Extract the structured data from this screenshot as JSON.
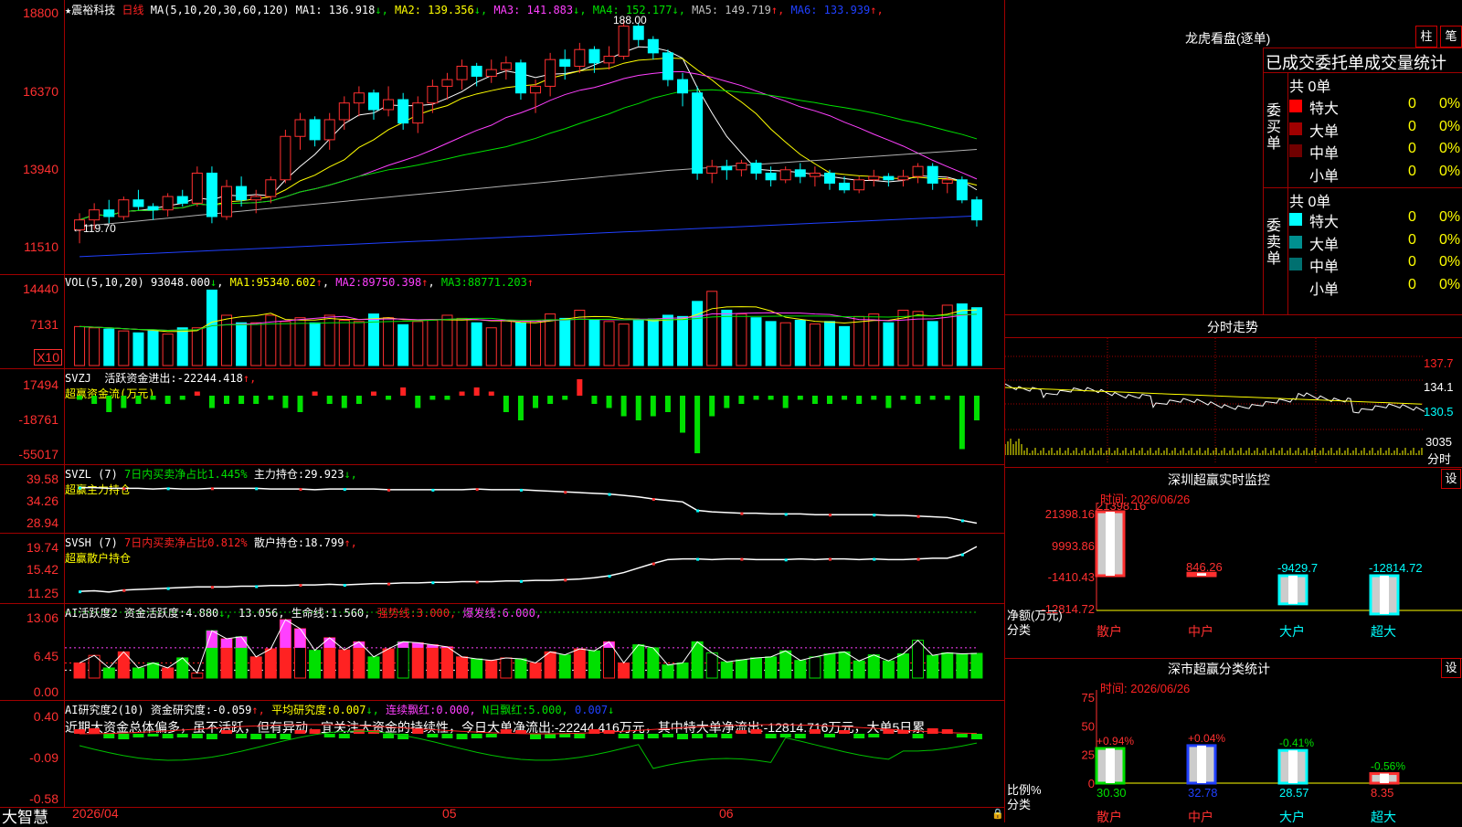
{
  "stock": {
    "name": "★震裕科技",
    "period": "日线"
  },
  "main": {
    "ma_header": "MA(5,10,20,30,60,120)",
    "ma": [
      {
        "label": "MA1:",
        "value": "136.918",
        "arrow": "↓",
        "color": "#ffffff"
      },
      {
        "label": "MA2:",
        "value": "139.356",
        "arrow": "↓",
        "color": "#ffff00"
      },
      {
        "label": "MA3:",
        "value": "141.883",
        "arrow": "↓",
        "color": "#ff40ff"
      },
      {
        "label": "MA4:",
        "value": "152.177",
        "arrow": "↓",
        "color": "#00e000"
      },
      {
        "label": "MA5:",
        "value": "149.719",
        "arrow": "↑",
        "color": "#c0c0c0"
      },
      {
        "label": "MA6:",
        "value": "133.939",
        "arrow": "↑",
        "color": "#2040ff"
      }
    ],
    "y_ticks": [
      "18800",
      "16370",
      "13940",
      "11510"
    ],
    "high_label": "188.00",
    "low_label": "119.70"
  },
  "volume": {
    "header": "VOL(5,10,20)",
    "value": "93048.000",
    "arrow": "↓",
    "ma": [
      {
        "label": "MA1:",
        "value": "95340.602",
        "arrow": "↑"
      },
      {
        "label": "MA2:",
        "value": "89750.398",
        "arrow": "↑"
      },
      {
        "label": "MA3:",
        "value": "88771.203",
        "arrow": "↑"
      }
    ],
    "y_ticks": [
      "14440",
      "7131"
    ],
    "unit": "X10"
  },
  "svzj": {
    "header": "SVZJ",
    "title": "活跃资金进出:",
    "value": "-22244.418",
    "arrow": "↑,",
    "sub": "超赢资金流(万元)",
    "y_ticks": [
      "17494",
      "-18761",
      "-55017"
    ]
  },
  "svzl": {
    "header": "SVZL (7)",
    "title": "7日内买卖净占比1.445%",
    "label2": "主力持仓:",
    "value": "29.923",
    "arrow": "↓,",
    "sub": "超赢主力持仓",
    "y_ticks": [
      "39.58",
      "34.26",
      "28.94"
    ]
  },
  "svsh": {
    "header": "SVSH (7)",
    "title": "7日内买卖净占比0.812%",
    "label2": "散户持仓:",
    "value": "18.799",
    "arrow": "↑,",
    "sub": "超赢散户持仓",
    "y_ticks": [
      "19.74",
      "15.42",
      "11.25"
    ]
  },
  "ai_active": {
    "header": "AI活跃度2",
    "l1": "资金活跃度:",
    "v1": "4.880",
    "a1": "↓,",
    "v2": "13.056,",
    "l3": "生命线:",
    "v3": "1.560,",
    "l4": "强势线:",
    "v4": "3.000,",
    "l5": "爆发线:",
    "v5": "6.000,",
    "y_ticks": [
      "13.06",
      "6.45",
      "0.00"
    ]
  },
  "ai_research": {
    "header": "AI研究度2(10)",
    "l1": "资金研究度:",
    "v1": "-0.059",
    "a1": "↑,",
    "l2": "平均研究度:",
    "v2": "0.007",
    "a2": "↓,",
    "l3": "连续飘红:",
    "v3": "0.000,",
    "l4": "N日飘红:",
    "v4": "5.000,",
    "v5": "0.007",
    "a5": "↓",
    "commentary": "近期大资金总体偏多，虽不活跃，但有异动，宜关注大资金的持续性，今日大单净流出:-22244.416万元，其中特大单净流出:-12814.716万元，大单5日累",
    "y_ticks": [
      "0.40",
      "-0.09",
      "-0.58"
    ]
  },
  "xaxis": {
    "labels": [
      "2026/04",
      "05",
      "06"
    ],
    "brand": "大智慧"
  },
  "right": {
    "lhb": {
      "title": "龙虎看盘(逐单)",
      "btn1": "柱",
      "btn2": "笔",
      "subtitle": "已成交委托单成交量统计",
      "buy": {
        "side": "委买单",
        "total": "共 0单",
        "rows": [
          {
            "name": "特大",
            "count": "0",
            "pct": "0%",
            "color": "#ff0000"
          },
          {
            "name": "大单",
            "count": "0",
            "pct": "0%",
            "color": "#a00000"
          },
          {
            "name": "中单",
            "count": "0",
            "pct": "0%",
            "color": "#700000"
          },
          {
            "name": "小单",
            "count": "0",
            "pct": "0%",
            "color": "#000000"
          }
        ]
      },
      "sell": {
        "side": "委卖单",
        "total": "共 0单",
        "rows": [
          {
            "name": "特大",
            "count": "0",
            "pct": "0%",
            "color": "#00ffff"
          },
          {
            "name": "大单",
            "count": "0",
            "pct": "0%",
            "color": "#009090"
          },
          {
            "name": "中单",
            "count": "0",
            "pct": "0%",
            "color": "#007070"
          },
          {
            "name": "小单",
            "count": "0",
            "pct": "0%",
            "color": "#000000"
          }
        ]
      }
    },
    "intraday": {
      "title": "分时走势",
      "y_ticks": [
        "137.7",
        "134.1",
        "130.5"
      ],
      "vol_tick": "3035",
      "vol_label": "分时"
    },
    "sz_monitor": {
      "title": "深圳超赢实时监控",
      "set": "设",
      "time": "时间: 2026/06/26",
      "y_ticks": [
        "21398.16",
        "9993.86",
        "-1410.43",
        "-12814.72"
      ],
      "y_unit": "净额(万元)",
      "y_unit2": "分类",
      "bars": [
        {
          "cat": "散户",
          "value": 21398.16,
          "label": "21398.16"
        },
        {
          "cat": "中户",
          "value": 846.26,
          "label": "846.26"
        },
        {
          "cat": "大户",
          "value": -9429.7,
          "label": "-9429.7"
        },
        {
          "cat": "超大",
          "value": -12814.72,
          "label": "-12814.72"
        }
      ]
    },
    "sz_class": {
      "title": "深市超赢分类统计",
      "set": "设",
      "time": "时间: 2026/06/26",
      "y_ticks": [
        "75",
        "50",
        "25",
        "0"
      ],
      "y_unit": "比例%",
      "y_unit2": "分类",
      "bars": [
        {
          "cat": "散户",
          "value": 30.3,
          "label": "30.30",
          "chg": "+0.94%"
        },
        {
          "cat": "中户",
          "value": 32.78,
          "label": "32.78",
          "chg": "+0.04%"
        },
        {
          "cat": "大户",
          "value": 28.57,
          "label": "28.57",
          "chg": "-0.41%"
        },
        {
          "cat": "超大",
          "value": 8.35,
          "label": "8.35",
          "chg": "-0.56%"
        }
      ]
    }
  },
  "chart_data": {
    "type": "candlestick",
    "candles": [
      [
        125,
        130,
        121,
        128
      ],
      [
        128,
        133,
        125,
        131
      ],
      [
        131,
        134,
        127,
        129
      ],
      [
        129,
        135,
        128,
        134
      ],
      [
        134,
        137,
        131,
        132
      ],
      [
        132,
        133,
        128,
        131
      ],
      [
        131,
        136,
        129,
        135
      ],
      [
        135,
        137,
        132,
        133
      ],
      [
        133,
        144,
        132,
        142
      ],
      [
        142,
        144,
        127,
        129
      ],
      [
        129,
        140,
        128,
        138
      ],
      [
        138,
        141,
        132,
        134
      ],
      [
        134,
        137,
        130,
        135
      ],
      [
        135,
        141,
        133,
        140
      ],
      [
        140,
        155,
        139,
        153
      ],
      [
        153,
        160,
        149,
        158
      ],
      [
        158,
        159,
        150,
        152
      ],
      [
        152,
        160,
        149,
        158
      ],
      [
        158,
        165,
        155,
        163
      ],
      [
        163,
        168,
        159,
        166
      ],
      [
        166,
        167,
        158,
        161
      ],
      [
        161,
        168,
        159,
        164
      ],
      [
        164,
        166,
        155,
        157
      ],
      [
        157,
        165,
        154,
        163
      ],
      [
        163,
        170,
        160,
        168
      ],
      [
        168,
        172,
        164,
        170
      ],
      [
        170,
        176,
        167,
        174
      ],
      [
        174,
        175,
        168,
        171
      ],
      [
        171,
        176,
        169,
        173
      ],
      [
        173,
        177,
        170,
        175
      ],
      [
        175,
        176,
        164,
        166
      ],
      [
        166,
        170,
        160,
        168
      ],
      [
        168,
        178,
        165,
        176
      ],
      [
        176,
        179,
        170,
        174
      ],
      [
        174,
        181,
        172,
        179
      ],
      [
        179,
        180,
        172,
        175
      ],
      [
        175,
        180,
        173,
        177
      ],
      [
        177,
        188,
        176,
        186
      ],
      [
        186,
        187,
        180,
        182
      ],
      [
        182,
        183,
        176,
        178
      ],
      [
        178,
        179,
        168,
        170
      ],
      [
        170,
        172,
        162,
        166
      ],
      [
        166,
        168,
        140,
        142
      ],
      [
        142,
        146,
        139,
        144
      ],
      [
        144,
        146,
        140,
        143
      ],
      [
        143,
        146,
        141,
        145
      ],
      [
        145,
        146,
        140,
        142
      ],
      [
        142,
        144,
        138,
        140
      ],
      [
        140,
        144,
        139,
        143
      ],
      [
        143,
        145,
        139,
        141
      ],
      [
        141,
        144,
        138,
        142
      ],
      [
        142,
        143,
        137,
        139
      ],
      [
        139,
        141,
        136,
        137
      ],
      [
        137,
        141,
        136,
        140
      ],
      [
        140,
        143,
        138,
        141
      ],
      [
        141,
        142,
        138,
        140
      ],
      [
        140,
        143,
        138,
        141
      ],
      [
        141,
        145,
        139,
        144
      ],
      [
        144,
        145,
        137,
        139
      ],
      [
        139,
        141,
        136,
        140
      ],
      [
        140,
        141,
        133,
        134
      ],
      [
        134,
        135,
        126,
        128
      ]
    ],
    "volume": [
      62,
      60,
      58,
      55,
      52,
      55,
      50,
      60,
      60,
      120,
      80,
      68,
      68,
      80,
      70,
      76,
      68,
      80,
      72,
      70,
      82,
      76,
      65,
      70,
      72,
      80,
      75,
      68,
      60,
      72,
      68,
      72,
      82,
      75,
      88,
      73,
      70,
      66,
      72,
      74,
      80,
      78,
      102,
      118,
      88,
      82,
      76,
      70,
      68,
      72,
      66,
      70,
      62,
      78,
      82,
      68,
      88,
      86,
      70,
      96,
      98,
      92
    ],
    "svzj": [
      -1,
      -2,
      -4,
      -3,
      -2,
      -1,
      -2,
      -1,
      1,
      -3,
      -2,
      -2,
      -2,
      -1,
      -3,
      -4,
      1,
      -2,
      -3,
      -2,
      1,
      -1,
      2,
      -3,
      -1,
      -1,
      1,
      2,
      1,
      -4,
      -6,
      -3,
      -2,
      -1,
      4,
      -2,
      -3,
      -5,
      -6,
      -5,
      -4,
      -9,
      -14,
      -5,
      -3,
      -2,
      -1,
      -1,
      -3,
      -1,
      -2,
      -2,
      -1,
      -2,
      -1,
      -3,
      -1,
      -2,
      -1,
      -1,
      -13,
      -6
    ],
    "svzl": [
      39.5,
      39.5,
      39.4,
      39.4,
      39.4,
      39.3,
      39.4,
      39.3,
      39.3,
      39.4,
      39.4,
      39.4,
      39.4,
      39.3,
      39.3,
      39.3,
      39.2,
      39.3,
      39.3,
      39.3,
      39.3,
      39.2,
      39.2,
      39.2,
      39.2,
      39.2,
      39.2,
      39.3,
      39.2,
      39.2,
      39.2,
      39.1,
      39.0,
      38.9,
      38.8,
      38.7,
      38.6,
      38.4,
      38.2,
      37.9,
      37.7,
      37.5,
      36.3,
      36.1,
      36.0,
      35.9,
      35.9,
      35.8,
      35.8,
      35.8,
      35.7,
      35.7,
      35.7,
      35.7,
      35.7,
      35.6,
      35.6,
      35.5,
      35.4,
      35.3,
      34.9,
      34.5
    ],
    "svsh": [
      11.9,
      12.0,
      11.8,
      12.1,
      12.2,
      12.3,
      12.4,
      12.5,
      12.6,
      12.6,
      12.6,
      12.7,
      12.7,
      12.8,
      12.8,
      12.9,
      12.9,
      13.0,
      12.9,
      13.0,
      13.1,
      13.1,
      13.2,
      13.2,
      13.3,
      13.3,
      13.4,
      13.4,
      13.4,
      13.5,
      13.5,
      13.6,
      13.6,
      13.7,
      13.8,
      14.0,
      14.3,
      14.8,
      15.5,
      16.2,
      16.8,
      16.9,
      16.9,
      16.8,
      16.9,
      16.9,
      16.8,
      16.8,
      16.8,
      16.9,
      16.8,
      16.9,
      16.9,
      16.8,
      16.9,
      16.8,
      16.8,
      16.9,
      17.0,
      17.0,
      17.6,
      18.8
    ],
    "ai_active": [
      3,
      4.5,
      2,
      5.2,
      2,
      3,
      2,
      4,
      1,
      9.4,
      7.8,
      8.2,
      4.2,
      5.8,
      11.6,
      9.8,
      5.5,
      8.0,
      5.6,
      7.2,
      4.2,
      5.8,
      7.2,
      7.0,
      6.6,
      6.2,
      4.2,
      3.8,
      3.5,
      4.0,
      3.8,
      3.0,
      5.2,
      4.6,
      5.8,
      5.4,
      7.2,
      3.0,
      6.6,
      6.0,
      2.6,
      3.0,
      7.2,
      5.0,
      3.2,
      3.6,
      4.0,
      4.2,
      5.4,
      3.5,
      4.2,
      4.8,
      5.2,
      3.4,
      4.6,
      3.4,
      4.8,
      7.5,
      4.5,
      5.0,
      4.8,
      4.9
    ],
    "ai_research": [
      0.05,
      0.06,
      -0.05,
      -0.06,
      -0.04,
      -0.03,
      -0.05,
      -0.04,
      -0.05,
      -0.06,
      0.04,
      -0.05,
      -0.06,
      -0.05,
      -0.06,
      0.04,
      0.05,
      -0.04,
      -0.05,
      0.05,
      0.04,
      -0.05,
      -0.06,
      0.05,
      -0.04,
      -0.05,
      -0.06,
      -0.05,
      -0.04,
      0.05,
      0.04,
      -0.06,
      -0.05,
      -0.04,
      -0.05,
      0.05,
      0.04,
      -0.05,
      -0.06,
      -0.05,
      -0.04,
      -0.06,
      -0.05,
      -0.04,
      -0.05,
      0.04,
      0.05,
      -0.05,
      -0.04,
      -0.05,
      0.05,
      -0.04,
      0.04,
      -0.05,
      -0.04,
      0.05,
      0.04,
      -0.05,
      0.06,
      0.05,
      -0.04,
      -0.06
    ]
  }
}
